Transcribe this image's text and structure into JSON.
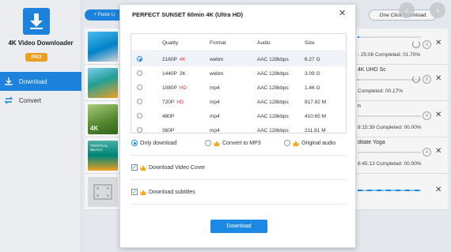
{
  "app": {
    "name": "4K Video Downloader",
    "pro_label": "PRO"
  },
  "sidebar": {
    "items": [
      {
        "label": "Download",
        "icon": "download-icon",
        "active": true
      },
      {
        "label": "Convert",
        "icon": "convert-icon",
        "active": false
      }
    ]
  },
  "toolbar": {
    "paste_label": "+ Paste Li",
    "one_click_label": "One Click Download"
  },
  "downloads": [
    {
      "title": "",
      "status": "- 25:06  Completed: 01.70%",
      "progress": 0.017
    },
    {
      "title": "4K UHD Sc",
      "status": "Completed: 00.17%",
      "progress": 0.0017
    },
    {
      "title": "n",
      "status": "8:15:39  Completed: 00.00%",
      "progress": 0.0
    },
    {
      "title": "ditate Yoga",
      "status": "6:45:13  Completed: 00.00%",
      "progress": 0.0
    },
    {
      "title": "",
      "status": "",
      "progress": 0.5
    }
  ],
  "dialog": {
    "title": "PERFECT SUNSET 60min 4K (Ultra HD)",
    "columns": [
      "Quality",
      "Format",
      "Audio",
      "Size"
    ],
    "rows": [
      {
        "quality": "2160P",
        "tag": "4K",
        "format": "webm",
        "audio": "AAC 128kbps",
        "size": "6.27 G",
        "selected": true
      },
      {
        "quality": "1440P",
        "tag": "2K",
        "format": "webm",
        "audio": "AAC 128kbps",
        "size": "3.09 G",
        "selected": false
      },
      {
        "quality": "1080P",
        "tag": "HD",
        "format": "mp4",
        "audio": "AAC 128kbps",
        "size": "1.46 G",
        "selected": false
      },
      {
        "quality": "720P",
        "tag": "HD",
        "format": "mp4",
        "audio": "AAC 128kbps",
        "size": "817.92 M",
        "selected": false
      },
      {
        "quality": "480P",
        "tag": "",
        "format": "mp4",
        "audio": "AAC 128kbps",
        "size": "410.65 M",
        "selected": false
      },
      {
        "quality": "360P",
        "tag": "",
        "format": "mp4",
        "audio": "AAC 128kbps",
        "size": "211.81 M",
        "selected": false
      }
    ],
    "options": {
      "only_download": "Only download",
      "convert_mp3": "Convert to MP3",
      "original_audio": "Original audio"
    },
    "download_cover": "Download Video Cover",
    "download_subtitles": "Download subtitles",
    "download_button": "Download"
  },
  "colors": {
    "accent": "#1e88e5",
    "hd_tag": "#e53935",
    "premium": "#f5a623"
  }
}
